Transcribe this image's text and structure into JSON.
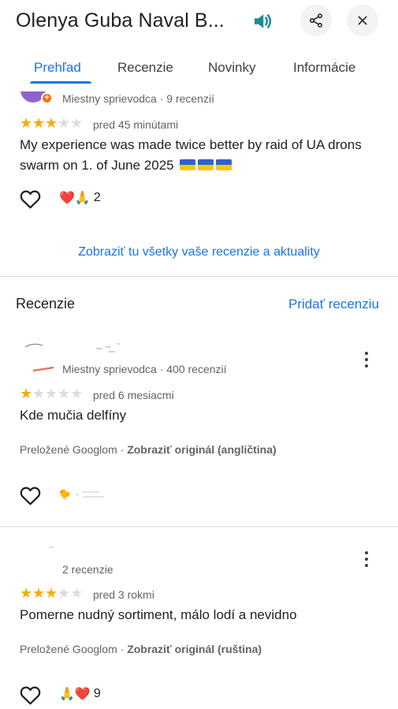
{
  "header": {
    "title": "Olenya Guba Naval B...",
    "speaker_icon": "volume-icon",
    "share_icon": "share-icon",
    "close_icon": "close-icon"
  },
  "tabs": [
    {
      "label": "Prehľad",
      "active": true
    },
    {
      "label": "Recenzie",
      "active": false
    },
    {
      "label": "Novinky",
      "active": false
    },
    {
      "label": "Informácie",
      "active": false
    }
  ],
  "colors": {
    "accent": "#1a73e8",
    "star": "#f9ab00",
    "star_off": "#dadce0",
    "avatar": "#8e63ce",
    "local_guide_badge": "#ff6d00"
  },
  "own_review": {
    "author_meta": "Miestny sprievodca · 9 recenzií",
    "rating": 3,
    "age": "pred 45 minútami",
    "text": "My experience was made twice better by raid of UA drons swarm on 1. of June 2025",
    "reactions": "❤️🙏",
    "reaction_count": "2"
  },
  "show_all_link": "Zobraziť tu všetky vaše recenzie a aktuality",
  "reviews_section": {
    "title": "Recenzie",
    "add_review": "Pridať recenziu"
  },
  "reviews": [
    {
      "author_meta": "Miestny sprievodca · 400 recenzií",
      "rating": 1,
      "age": "pred 6 mesiacmi",
      "text": "Kde mučia delfíny",
      "translated_prefix": "Preložené Googlom · ",
      "translated_link": "Zobraziť originál (angličtina)",
      "reactions": "🐤"
    },
    {
      "author_meta": "2 recenzie",
      "rating": 3,
      "age": "pred 3 rokmi",
      "text": "Pomerne nudný sortiment, málo lodí a nevidno",
      "translated_prefix": "Preložené Googlom · ",
      "translated_link": "Zobraziť originál (ruština)",
      "reactions": "🙏❤️",
      "reaction_count": "9"
    }
  ]
}
